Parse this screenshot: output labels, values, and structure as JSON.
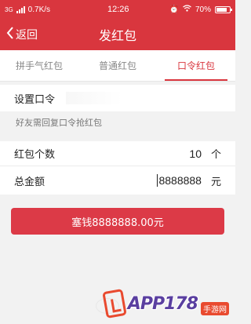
{
  "status_bar": {
    "network": "3G",
    "speed": "0.7K/s",
    "time": "12:26",
    "battery": "70%"
  },
  "nav": {
    "back_label": "返回",
    "title": "发红包"
  },
  "tabs": [
    {
      "label": "拼手气红包",
      "active": false
    },
    {
      "label": "普通红包",
      "active": false
    },
    {
      "label": "口令红包",
      "active": true
    }
  ],
  "form": {
    "password_label": "设置口令",
    "password_value": "",
    "hint": "好友需回复口令抢红包",
    "count_label": "红包个数",
    "count_value": "10",
    "count_unit": "个",
    "amount_label": "总金额",
    "amount_value": "8888888",
    "amount_unit": "元"
  },
  "submit": {
    "label": "塞钱8888888.00元"
  },
  "watermark": {
    "text": "APP178",
    "sub": "手游网"
  },
  "colors": {
    "primary": "#d9363e",
    "button": "#dc3a47"
  }
}
